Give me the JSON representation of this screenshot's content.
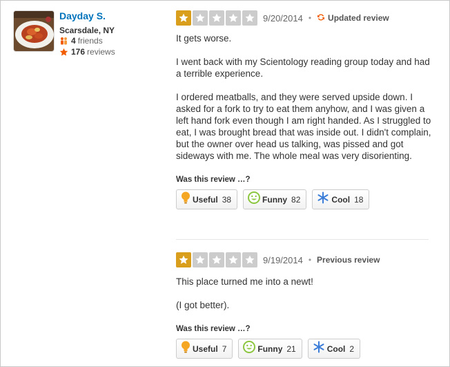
{
  "user": {
    "name": "Dayday S.",
    "location": "Scarsdale, NY",
    "friends_count": "4",
    "friends_label": "friends",
    "reviews_count": "176",
    "reviews_label": "reviews"
  },
  "reviews": [
    {
      "rating": 1,
      "max_rating": 5,
      "date": "9/20/2014",
      "tag": "Updated review",
      "paragraphs": [
        "It gets worse.",
        "I went back with my Scientology reading group today and had a terrible experience.",
        "I ordered meatballs, and they were served upside down. I asked for a fork to try to eat them anyhow, and I was given a left hand fork even though I am right handed. As I struggled to eat, I was brought bread that was inside out.  I didn't complain, but the owner over head us talking, was pissed and got sideways with me.  The whole meal was very disorienting."
      ],
      "was_label": "Was this review …?",
      "votes": {
        "useful_label": "Useful",
        "useful": "38",
        "funny_label": "Funny",
        "funny": "82",
        "cool_label": "Cool",
        "cool": "18"
      }
    },
    {
      "rating": 1,
      "max_rating": 5,
      "date": "9/19/2014",
      "tag": "Previous review",
      "paragraphs": [
        "This place turned me into a newt!",
        "(I got better)."
      ],
      "was_label": "Was this review …?",
      "votes": {
        "useful_label": "Useful",
        "useful": "7",
        "funny_label": "Funny",
        "funny": "21",
        "cool_label": "Cool",
        "cool": "2"
      }
    }
  ],
  "colors": {
    "user_link": "#0073bb",
    "star_on": "#d99e1c",
    "star_off": "#cccccc",
    "updated_icon": "#f15c00",
    "useful_icon": "#f5a623",
    "funny_icon": "#8cc63f",
    "cool_icon": "#3b7dd8"
  },
  "icons": {
    "friends": "friends-icon",
    "reviews": "star-icon",
    "updated": "refresh-icon",
    "useful": "lightbulb-icon",
    "funny": "smiley-icon",
    "cool": "snowflake-icon"
  }
}
